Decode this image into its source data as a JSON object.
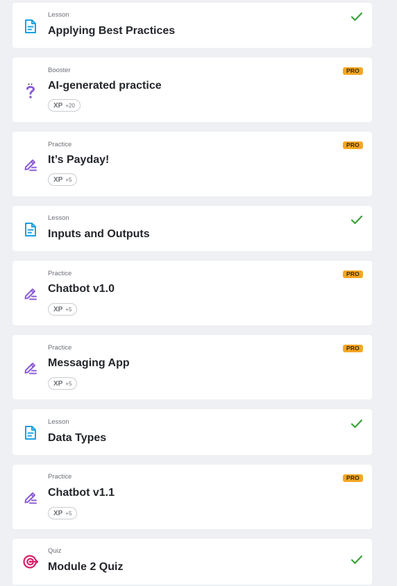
{
  "colors": {
    "lesson_icon": "#1ba1e2",
    "practice_icon": "#8a5cd6",
    "booster_icon": "#8a5cd6",
    "quiz_icon": "#d61f69",
    "check": "#3ba13a",
    "pro_badge": "#f5a623",
    "background": "#eef0f3"
  },
  "xp_label": "XP",
  "pro_label": "PRO",
  "items": [
    {
      "type": "Lesson",
      "icon": "lesson-icon",
      "title": "Applying Best Practices",
      "status": "completed"
    },
    {
      "type": "Booster",
      "icon": "question-icon",
      "title": "AI-generated practice",
      "status": "pro",
      "xp": "+20"
    },
    {
      "type": "Practice",
      "icon": "pencil-icon",
      "title": "It’s Payday!",
      "status": "pro",
      "xp": "+5"
    },
    {
      "type": "Lesson",
      "icon": "lesson-icon",
      "title": "Inputs and Outputs",
      "status": "completed"
    },
    {
      "type": "Practice",
      "icon": "pencil-icon",
      "title": "Chatbot v1.0",
      "status": "pro",
      "xp": "+5"
    },
    {
      "type": "Practice",
      "icon": "pencil-icon",
      "title": "Messaging App",
      "status": "pro",
      "xp": "+5"
    },
    {
      "type": "Lesson",
      "icon": "lesson-icon",
      "title": "Data Types",
      "status": "completed"
    },
    {
      "type": "Practice",
      "icon": "pencil-icon",
      "title": "Chatbot v1.1",
      "status": "pro",
      "xp": "+5"
    },
    {
      "type": "Quiz",
      "icon": "target-icon",
      "title": "Module 2 Quiz",
      "status": "completed"
    }
  ]
}
